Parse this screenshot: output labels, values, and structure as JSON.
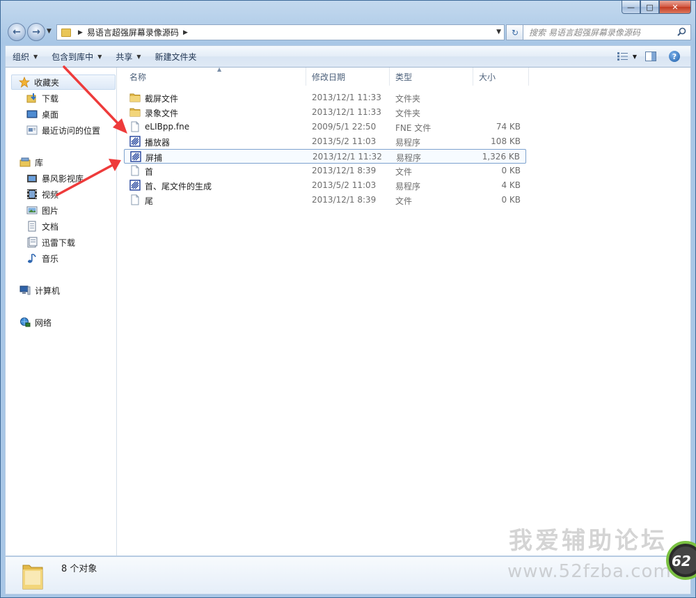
{
  "window": {
    "caption": {
      "minimize": "—",
      "maximize": "□",
      "close": "✕"
    }
  },
  "address": {
    "path": "易语言超强屏幕录像源码",
    "search_placeholder": "搜索 易语言超强屏幕录像源码"
  },
  "toolbar": {
    "organize": "组织",
    "include_in_library": "包含到库中",
    "share": "共享",
    "new_folder": "新建文件夹"
  },
  "navpane": {
    "favorites": "收藏夹",
    "favorites_items": [
      "下载",
      "桌面",
      "最近访问的位置"
    ],
    "libraries": "库",
    "library_items": [
      "暴风影视库",
      "视频",
      "图片",
      "文档",
      "迅雷下载",
      "音乐"
    ],
    "computer": "计算机",
    "network": "网络"
  },
  "columns": {
    "name": "名称",
    "date": "修改日期",
    "type": "类型",
    "size": "大小"
  },
  "files": [
    {
      "name": "截屏文件",
      "date": "2013/12/1 11:33",
      "type": "文件夹",
      "size": "",
      "icon": "folder-icon"
    },
    {
      "name": "录象文件",
      "date": "2013/12/1 11:33",
      "type": "文件夹",
      "size": "",
      "icon": "folder-icon"
    },
    {
      "name": "eLIBpp.fne",
      "date": "2009/5/1 22:50",
      "type": "FNE 文件",
      "size": "74 KB",
      "icon": "file-icon"
    },
    {
      "name": "播放器",
      "date": "2013/5/2 11:03",
      "type": "易程序",
      "size": "108 KB",
      "icon": "e-program-icon"
    },
    {
      "name": "屏捕",
      "date": "2013/12/1 11:32",
      "type": "易程序",
      "size": "1,326 KB",
      "icon": "e-program-icon"
    },
    {
      "name": "首",
      "date": "2013/12/1 8:39",
      "type": "文件",
      "size": "0 KB",
      "icon": "file-icon"
    },
    {
      "name": "首、尾文件的生成",
      "date": "2013/5/2 11:03",
      "type": "易程序",
      "size": "4 KB",
      "icon": "e-program-icon"
    },
    {
      "name": "尾",
      "date": "2013/12/1 8:39",
      "type": "文件",
      "size": "0 KB",
      "icon": "file-icon"
    }
  ],
  "details": {
    "count": "8 个对象"
  },
  "watermark": {
    "line1": "我爱辅助论坛",
    "line2": "www.52fzba.com",
    "badge": "62"
  },
  "colors": {
    "annotation_arrow": "#ee3b3b",
    "selection_border": "#7da2ce"
  }
}
